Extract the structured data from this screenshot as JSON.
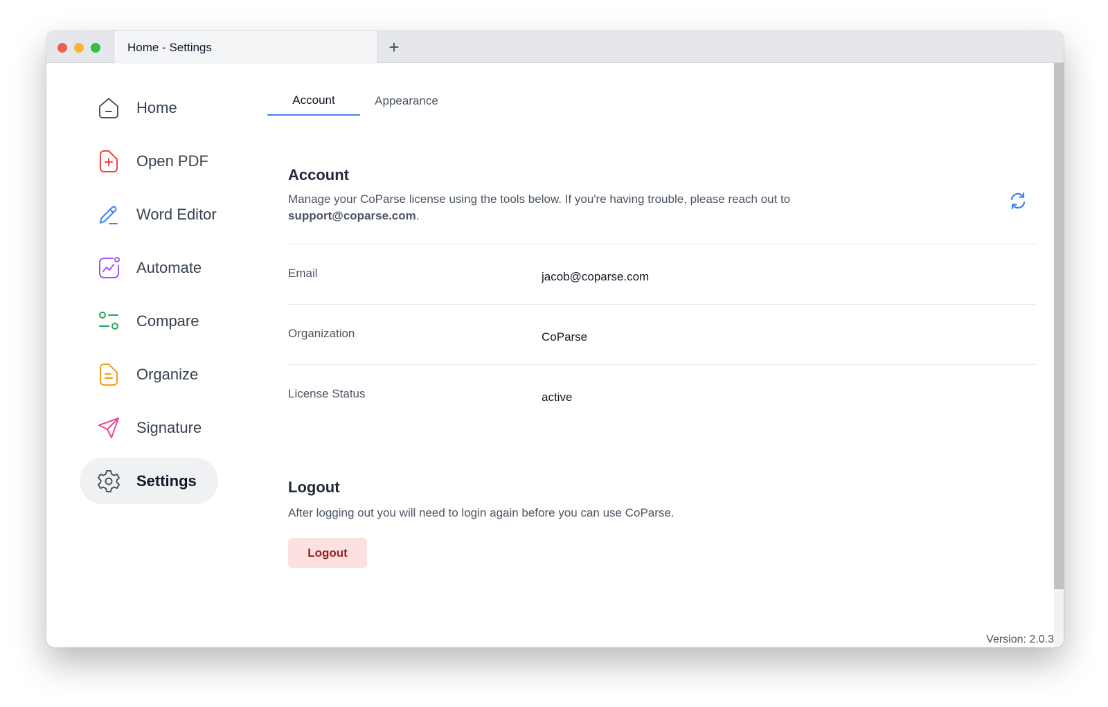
{
  "window": {
    "tab_title": "Home - Settings",
    "new_tab_symbol": "+"
  },
  "sidebar": {
    "items": [
      {
        "label": "Home",
        "icon": "home-icon",
        "color": "#4b5563"
      },
      {
        "label": "Open PDF",
        "icon": "file-plus-icon",
        "color": "#ef4444"
      },
      {
        "label": "Word Editor",
        "icon": "pen-icon",
        "color": "#3b82f6"
      },
      {
        "label": "Automate",
        "icon": "chart-bubble-icon",
        "color": "#a855f7"
      },
      {
        "label": "Compare",
        "icon": "toggle-compare-icon",
        "color": "#22a55b"
      },
      {
        "label": "Organize",
        "icon": "document-lines-icon",
        "color": "#f59e0b"
      },
      {
        "label": "Signature",
        "icon": "send-icon",
        "color": "#ec4899"
      },
      {
        "label": "Settings",
        "icon": "gear-icon",
        "color": "#4b5563",
        "active": true
      }
    ]
  },
  "tabs": {
    "account": "Account",
    "appearance": "Appearance",
    "active": "Account"
  },
  "account": {
    "title": "Account",
    "description": "Manage your CoParse license using the tools below. If you're having trouble, please reach out to",
    "support_email": "support@coparse.com",
    "description_end": ".",
    "rows": [
      {
        "label": "Email",
        "value": "jacob@coparse.com"
      },
      {
        "label": "Organization",
        "value": "CoParse"
      },
      {
        "label": "License Status",
        "value": "active"
      }
    ]
  },
  "logout": {
    "title": "Logout",
    "description": "After logging out you will need to login again before you can use CoParse.",
    "button_label": "Logout"
  },
  "footer": {
    "version": "Version: 2.0.3"
  },
  "colors": {
    "accent": "#3b82f6",
    "danger_bg": "#fde1e1",
    "danger_text": "#9b1c1c"
  }
}
